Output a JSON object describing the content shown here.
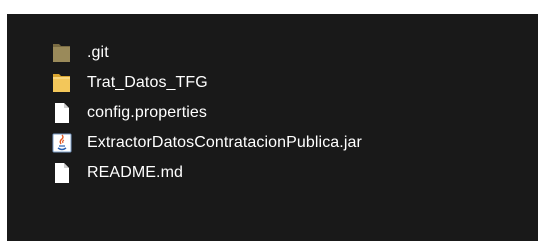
{
  "files": [
    {
      "name": ".git",
      "icon": "folder-icon",
      "color": "#9a8a5a"
    },
    {
      "name": "Trat_Datos_TFG",
      "icon": "folder-icon",
      "color": "#f3c75a"
    },
    {
      "name": "config.properties",
      "icon": "file-icon",
      "color": "#ffffff"
    },
    {
      "name": "ExtractorDatosContratacionPublica.jar",
      "icon": "java-jar-icon",
      "color": "#ffffff"
    },
    {
      "name": "README.md",
      "icon": "file-icon",
      "color": "#ffffff"
    }
  ],
  "colors": {
    "background": "#191919",
    "text": "#ffffff"
  }
}
